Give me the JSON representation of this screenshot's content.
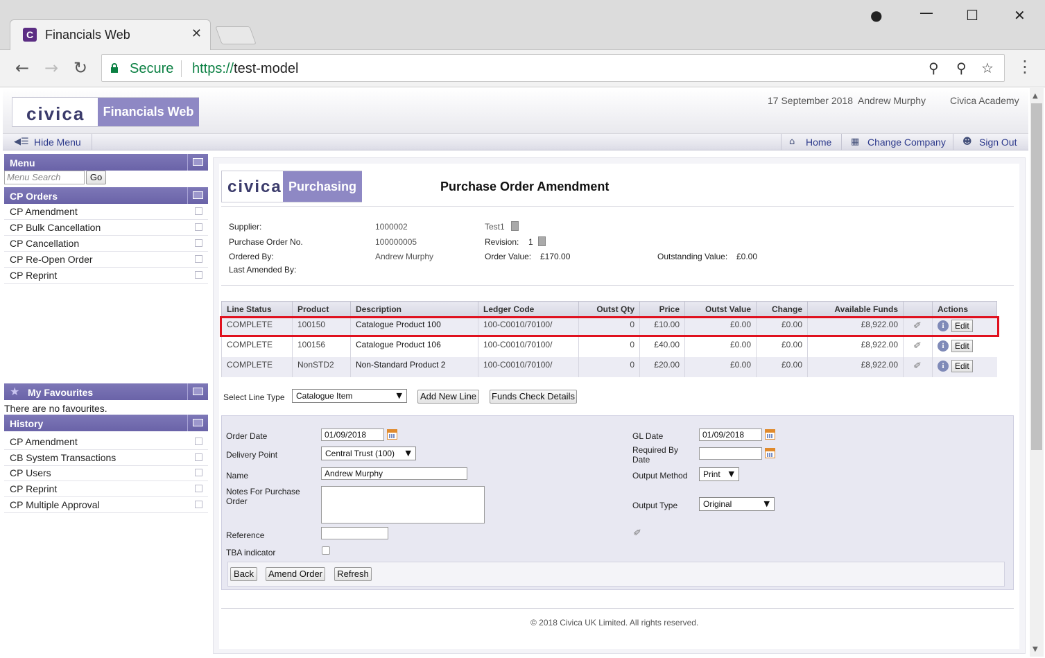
{
  "browser": {
    "tab_title": "Financials Web",
    "favicon_letter": "C",
    "close_glyph": "✕",
    "secure_label": "Secure",
    "url_scheme": "https://",
    "url_host": "test-model"
  },
  "header": {
    "brand_logo": "civica",
    "brand_product": "Financials Web",
    "date": "17 September 2018",
    "user": "Andrew Murphy",
    "company": "Civica Academy"
  },
  "menubar": {
    "hide_menu": "Hide Menu",
    "home": "Home",
    "change_company": "Change Company",
    "sign_out": "Sign Out"
  },
  "sidebar": {
    "menu_title": "Menu",
    "search_placeholder": "Menu Search",
    "go_label": "Go",
    "cp_orders_title": "CP Orders",
    "cp_orders_items": [
      "CP Amendment",
      "CP Bulk Cancellation",
      "CP Cancellation",
      "CP Re-Open Order",
      "CP Reprint"
    ],
    "favourites_title": "My Favourites",
    "favourites_empty": "There are no favourites.",
    "history_title": "History",
    "history_items": [
      "CP Amendment",
      "CB System Transactions",
      "CP Users",
      "CP Reprint",
      "CP Multiple Approval"
    ]
  },
  "main": {
    "module_logo": "civica",
    "module_label": "Purchasing",
    "title": "Purchase Order Amendment",
    "supplier_label": "Supplier:",
    "supplier_code": "1000002",
    "supplier_name": "Test1",
    "po_label": "Purchase Order No.",
    "po_number": "100000005",
    "revision_label": "Revision:",
    "revision": "1",
    "ordered_by_label": "Ordered By:",
    "ordered_by": "Andrew Murphy",
    "order_value_label": "Order Value:",
    "order_value": "£170.00",
    "outstanding_label": "Outstanding Value:",
    "outstanding_value": "£0.00",
    "last_amended_label": "Last Amended By:"
  },
  "table": {
    "headers": [
      "Line Status",
      "Product",
      "Description",
      "Ledger Code",
      "Outst Qty",
      "Price",
      "Outst Value",
      "Change",
      "Available Funds",
      "",
      "Actions"
    ],
    "edit_label": "Edit",
    "rows": [
      {
        "status": "COMPLETE",
        "product": "100150",
        "description": "Catalogue Product 100",
        "ledger": "100-C0010/70100/",
        "qty": "0",
        "price": "£10.00",
        "outst_value": "£0.00",
        "change": "£0.00",
        "funds": "£8,922.00"
      },
      {
        "status": "COMPLETE",
        "product": "100156",
        "description": "Catalogue Product 106",
        "ledger": "100-C0010/70100/",
        "qty": "0",
        "price": "£40.00",
        "outst_value": "£0.00",
        "change": "£0.00",
        "funds": "£8,922.00"
      },
      {
        "status": "COMPLETE",
        "product": "NonSTD2",
        "description": "Non-Standard Product 2",
        "ledger": "100-C0010/70100/",
        "qty": "0",
        "price": "£20.00",
        "outst_value": "£0.00",
        "change": "£0.00",
        "funds": "£8,922.00"
      }
    ]
  },
  "line_type": {
    "label": "Select Line Type",
    "value": "Catalogue Item",
    "add_new_line": "Add New Line",
    "funds_check": "Funds Check Details"
  },
  "form": {
    "order_date_label": "Order Date",
    "order_date": "01/09/2018",
    "delivery_point_label": "Delivery Point",
    "delivery_point": "Central Trust (100)",
    "name_label": "Name",
    "name": "Andrew Murphy",
    "notes_label": "Notes For Purchase Order",
    "reference_label": "Reference",
    "tba_label": "TBA indicator",
    "gl_date_label": "GL Date",
    "gl_date": "01/09/2018",
    "required_by_label": "Required By Date",
    "output_method_label": "Output Method",
    "output_method": "Print",
    "output_type_label": "Output Type",
    "output_type": "Original",
    "back": "Back",
    "amend_order": "Amend Order",
    "refresh": "Refresh"
  },
  "footer": "© 2018 Civica UK Limited. All rights reserved."
}
